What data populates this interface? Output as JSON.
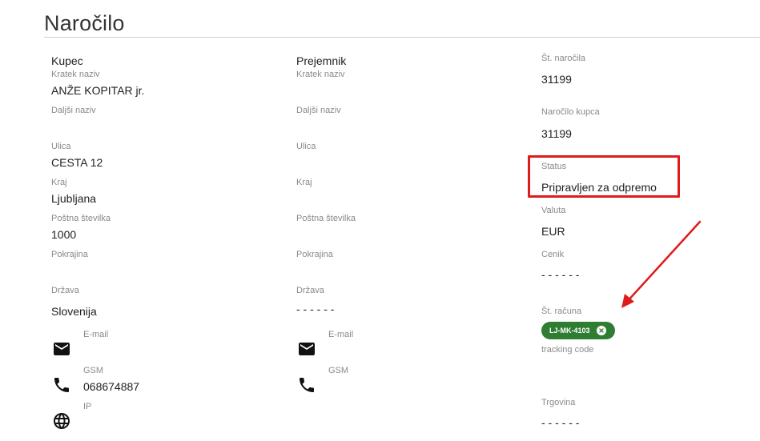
{
  "page": {
    "title": "Naročilo"
  },
  "buyer": {
    "heading": "Kupec",
    "short_name": {
      "label": "Kratek naziv",
      "value": "ANŽE KOPITAR jr."
    },
    "long_name": {
      "label": "Daljši naziv",
      "value": ""
    },
    "street": {
      "label": "Ulica",
      "value": "CESTA 12"
    },
    "city": {
      "label": "Kraj",
      "value": "Ljubljana"
    },
    "postal": {
      "label": "Poštna številka",
      "value": "1000"
    },
    "region": {
      "label": "Pokrajina",
      "value": ""
    },
    "country": {
      "label": "Država",
      "value": "Slovenija"
    },
    "email": {
      "label": "E-mail",
      "value": "",
      "icon": "email-icon"
    },
    "gsm": {
      "label": "GSM",
      "value": "068674887",
      "icon": "phone-icon"
    },
    "ip": {
      "label": "IP",
      "value": "",
      "icon": "globe-icon"
    }
  },
  "recipient": {
    "heading": "Prejemnik",
    "short_name": {
      "label": "Kratek naziv",
      "value": ""
    },
    "long_name": {
      "label": "Daljši naziv",
      "value": ""
    },
    "street": {
      "label": "Ulica",
      "value": ""
    },
    "city": {
      "label": "Kraj",
      "value": ""
    },
    "postal": {
      "label": "Poštna številka",
      "value": ""
    },
    "region": {
      "label": "Pokrajina",
      "value": ""
    },
    "country": {
      "label": "Država",
      "value": "- - - - - -"
    },
    "email": {
      "label": "E-mail",
      "value": "",
      "icon": "email-icon"
    },
    "gsm": {
      "label": "GSM",
      "value": "",
      "icon": "phone-icon"
    }
  },
  "order": {
    "number": {
      "label": "Št. naročila",
      "value": "31199"
    },
    "customer_order": {
      "label": "Naročilo kupca",
      "value": "31199"
    },
    "status": {
      "label": "Status",
      "value": "Pripravljen za odpremo"
    },
    "currency": {
      "label": "Valuta",
      "value": "EUR"
    },
    "pricelist": {
      "label": "Cenik",
      "value": "- - - - - -"
    },
    "invoice": {
      "label": "Št. računa",
      "chip": "LJ-MK-4103"
    },
    "tracking": {
      "label": "tracking code"
    },
    "store": {
      "label": "Trgovina",
      "value": "- - - - - -"
    }
  },
  "colors": {
    "highlight": "#e01b1b",
    "chip": "#2e7d32"
  }
}
